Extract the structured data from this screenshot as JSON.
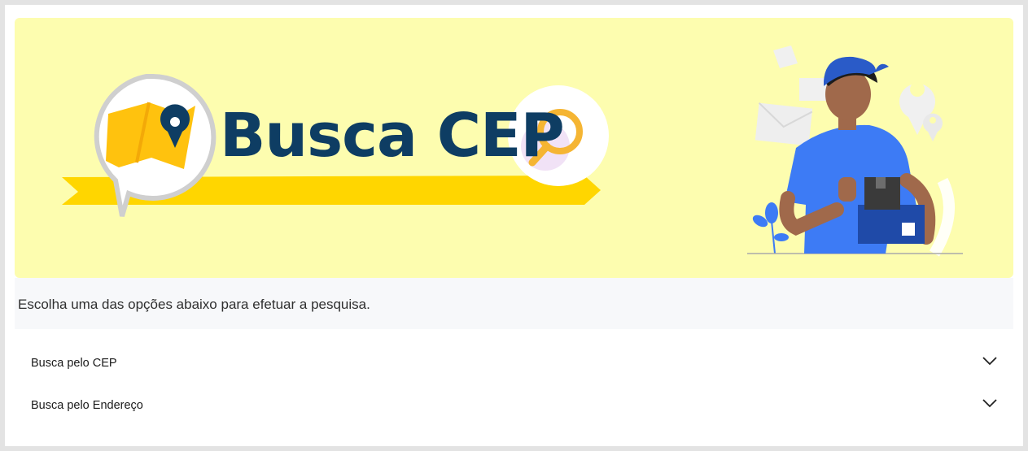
{
  "banner": {
    "brand_title": "Busca CEP",
    "colors": {
      "background": "#fdfdaf",
      "title": "#0e3d63",
      "ribbon": "#ffd600",
      "pin": "#0e3d63",
      "uniform": "#3d7bf5",
      "magnifier": "#f5b533"
    },
    "icons": [
      "map-pin-icon",
      "magnifier-icon",
      "location-pin-icon",
      "envelope-icon"
    ]
  },
  "intro": {
    "text": "Escolha uma das opções abaixo para efetuar a pesquisa."
  },
  "accordion": {
    "items": [
      {
        "label": "Busca pelo CEP",
        "icon": "chevron-down-icon"
      },
      {
        "label": "Busca pelo Endereço",
        "icon": "chevron-down-icon"
      }
    ]
  }
}
